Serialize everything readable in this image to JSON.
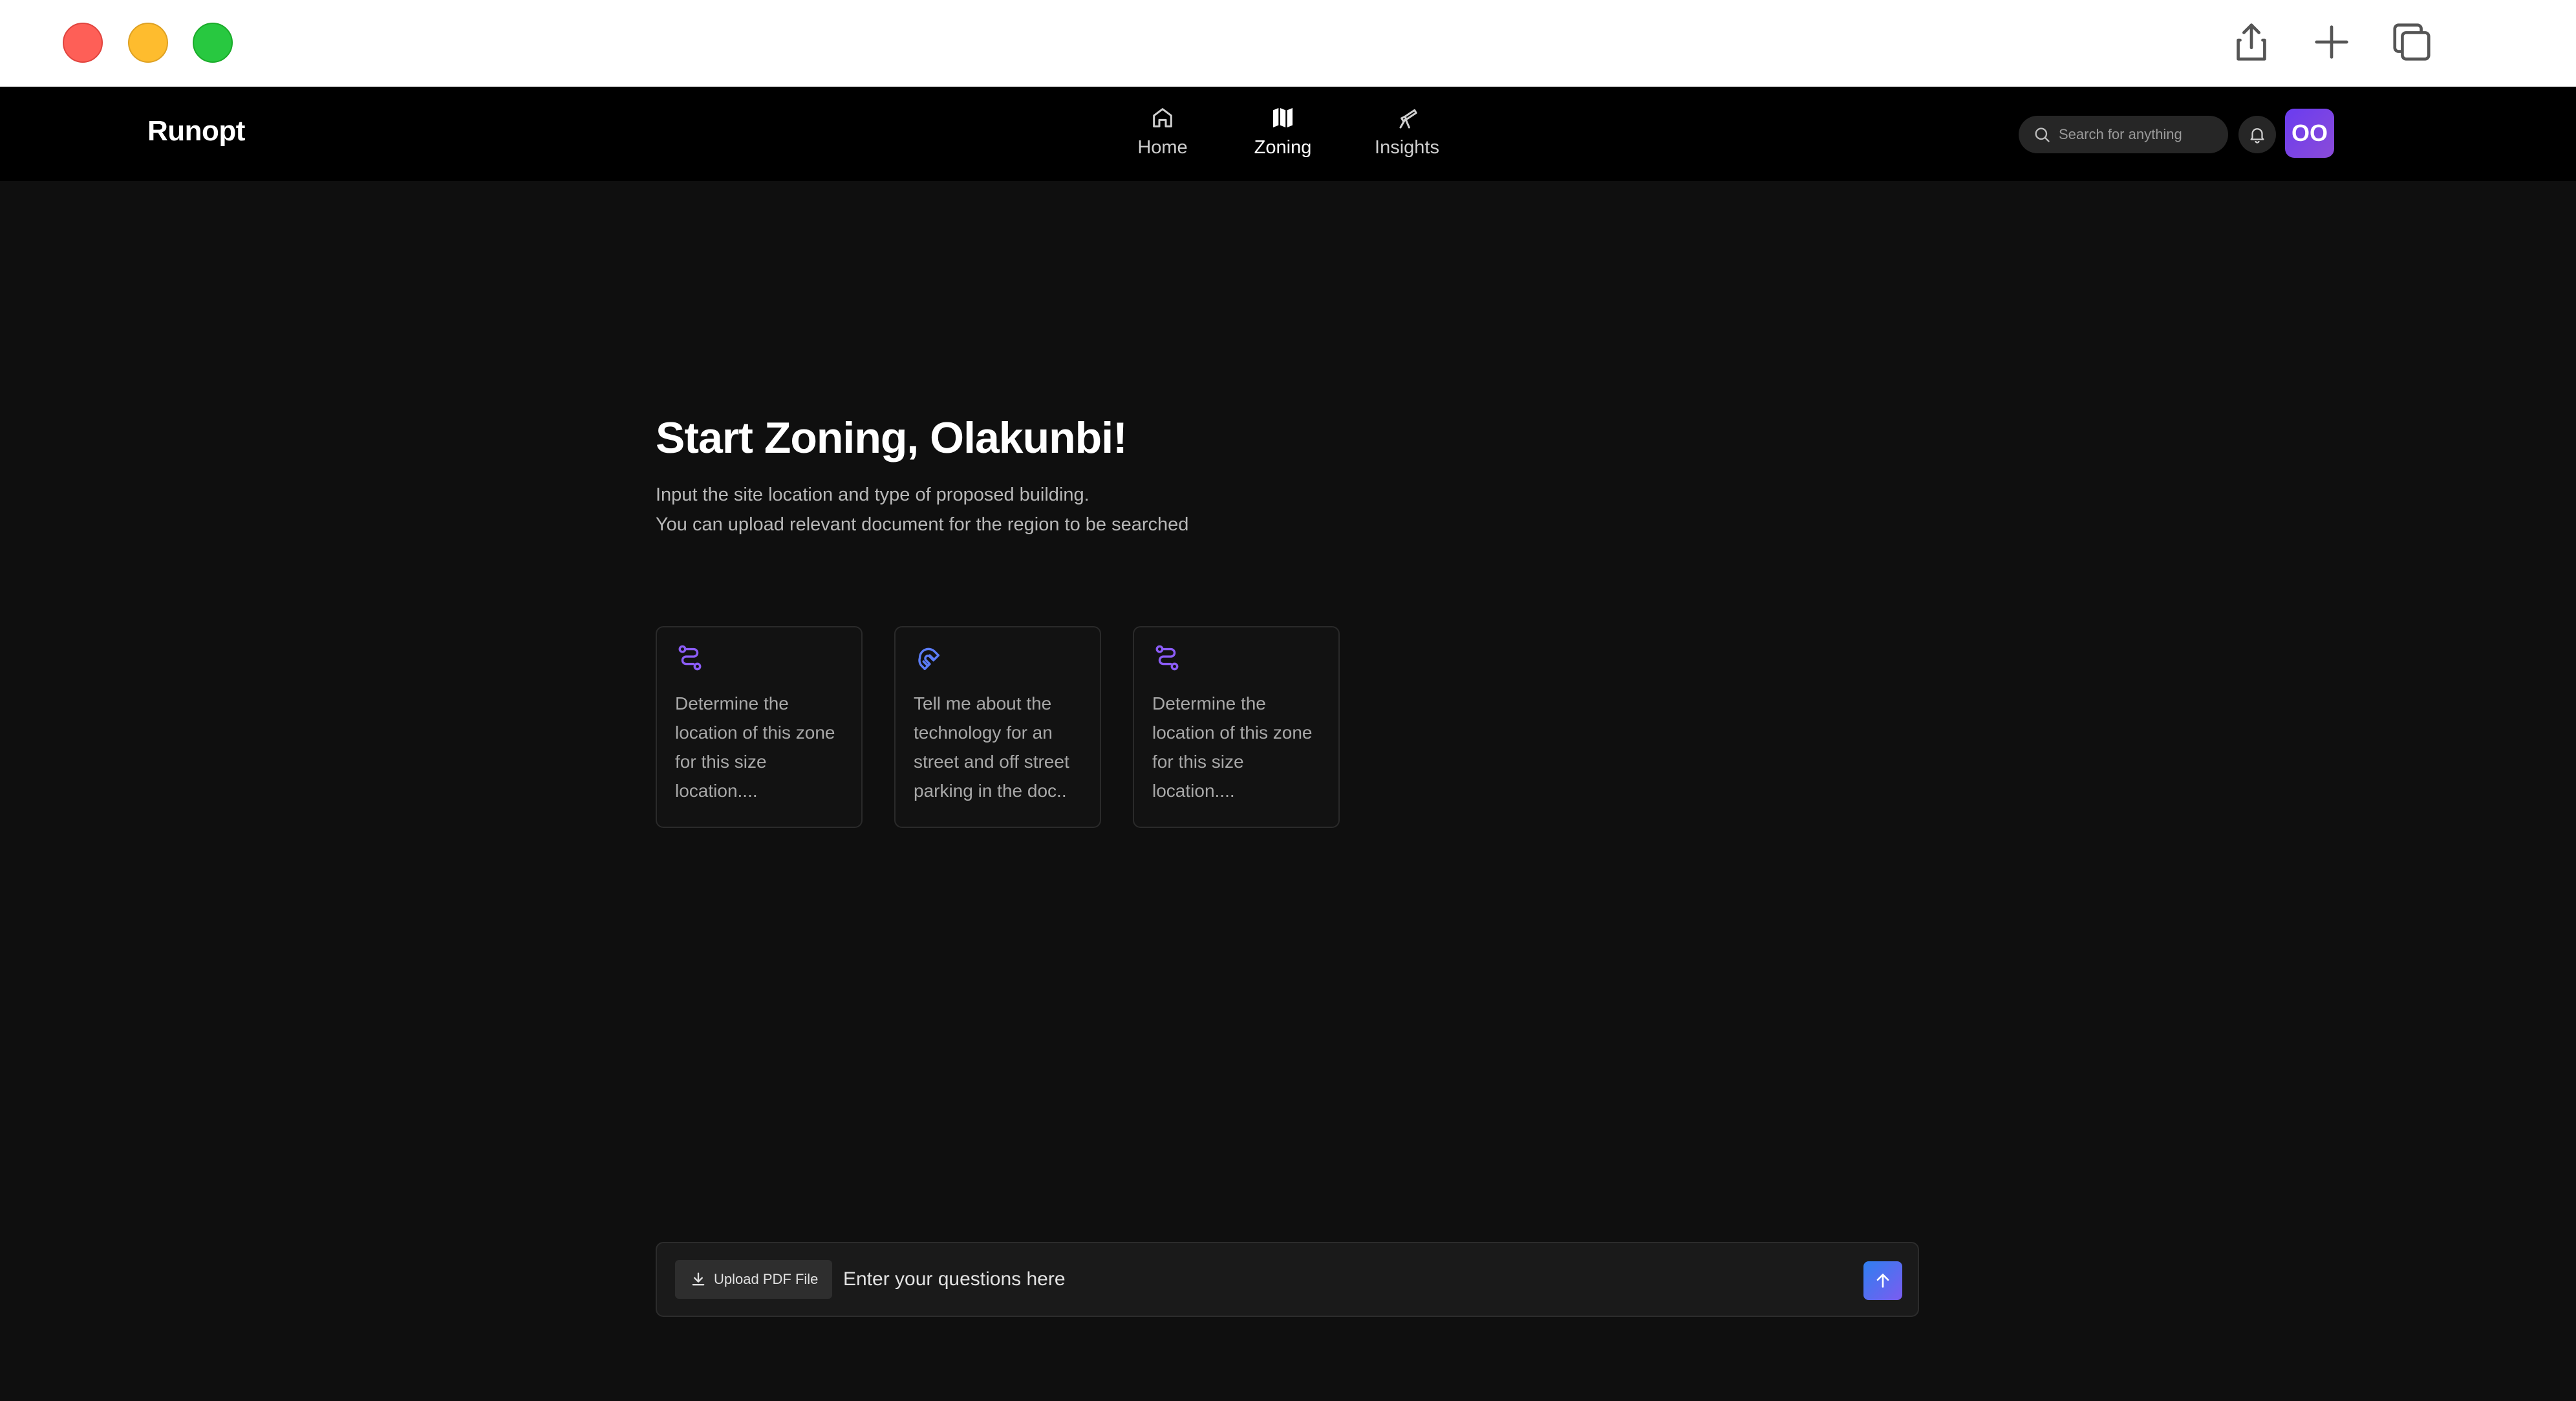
{
  "window": {
    "controls": [
      "close",
      "minimize",
      "maximize"
    ],
    "actions": [
      {
        "icon": "share-icon"
      },
      {
        "icon": "plus-icon"
      },
      {
        "icon": "copy-windows-icon"
      }
    ]
  },
  "app": {
    "brand": "Runopt",
    "nav": [
      {
        "label": "Home",
        "icon": "home-icon",
        "active": false
      },
      {
        "label": "Zoning",
        "icon": "map-icon",
        "active": true
      },
      {
        "label": "Insights",
        "icon": "telescope-icon",
        "active": false
      }
    ],
    "search": {
      "placeholder": "Search for anything"
    },
    "avatar": {
      "initials": "OO"
    }
  },
  "main": {
    "title": "Start Zoning, Olakunbi!",
    "subtitle_line1": "Input the site location and type of proposed building.",
    "subtitle_line2": "You can upload relevant document for the region to be searched",
    "cards": [
      {
        "icon": "route-icon",
        "text": "Determine the location of this zone for this size location...."
      },
      {
        "icon": "magnet-icon",
        "text": "Tell me about the technology for an street and off street parking in the doc.."
      },
      {
        "icon": "route-icon",
        "text": "Determine the location of this zone for this size location...."
      }
    ]
  },
  "composer": {
    "upload_label": "Upload PDF File",
    "placeholder": "Enter your questions here"
  },
  "colors": {
    "background": "#0f0f0f",
    "navbar": "#000000",
    "accent_purple": "#7b4ff0",
    "accent_blue": "#3d7df0"
  }
}
